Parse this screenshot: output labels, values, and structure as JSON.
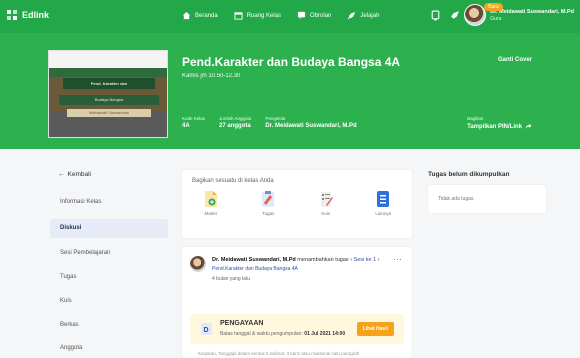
{
  "app": {
    "name": "Edlink"
  },
  "nav": {
    "home": "Beranda",
    "rooms": "Ruang Kelas",
    "discussion": "Obrolan",
    "schedule": "Jelajah"
  },
  "user": {
    "badge": "Baru",
    "name": "Dr. Meidawati Suswandari, M.Pd",
    "role": "Guru"
  },
  "class": {
    "title": "Pend.Karakter dan Budaya Bangsa 4A",
    "time": "Kamis jm 10.50-12.30",
    "edit_cover": "Ganti Cover",
    "cover_text": [
      "Pend. Karakter dan",
      "Budaya Bangsa",
      "Meidawati Suswandari"
    ],
    "meta": [
      {
        "label": "Kode Kelas",
        "value": "4A"
      },
      {
        "label": "Jumlah Anggota",
        "value": "27 anggota"
      },
      {
        "label": "Pengelola",
        "value": "Dr. Meidawati Suswandari, M.Pd"
      }
    ],
    "share": {
      "label": "Bagikan",
      "value": "Tampilkan PIN/Link"
    }
  },
  "sidebar": {
    "back": "Kembali",
    "items": [
      {
        "label": "Informasi Kelas",
        "active": false
      },
      {
        "label": "Diskusi",
        "active": true
      },
      {
        "label": "Sesi Pembelajaran",
        "active": false
      },
      {
        "label": "Tugas",
        "active": false
      },
      {
        "label": "Kuis",
        "active": false
      },
      {
        "label": "Berkas",
        "active": false
      },
      {
        "label": "Anggota",
        "active": false
      }
    ]
  },
  "share_box": {
    "title": "Bagikan sesuatu di kelas Anda",
    "tiles": [
      {
        "label": "Materi",
        "icon": "material-icon",
        "color": "#f3b33d"
      },
      {
        "label": "Tugas",
        "icon": "assignment-icon",
        "color": "#e85d4a"
      },
      {
        "label": "Kuis",
        "icon": "quiz-icon",
        "color": "#888888"
      },
      {
        "label": "Lainnya",
        "icon": "other-icon",
        "color": "#2f6fe0"
      }
    ]
  },
  "post": {
    "author": "Dr. Meidawati Suswandari, M.Pd",
    "action": "menambahkan tugas",
    "session": "Sesi ke 1",
    "class_name": "Pend.Karakter dan Budaya Bangsa 4A",
    "time": "4 bulan yang lalu",
    "assignment": {
      "title": "PENGAYAAN",
      "due_label": "Batas tanggal & waktu pengumpulan:",
      "due_value": "01 Jul 2021 14:00",
      "button": "Lihat Hasil"
    },
    "footer": "Kerjakan, Tanggapi dalam bentuk 5 kalimat. 3 baris atau maksimal satu paragraf!"
  },
  "pending": {
    "title": "Tugas belum dikumpulkan",
    "empty": "Tidak ada tugas."
  },
  "colors": {
    "primary_green": "#23a849",
    "banner_green": "#2db14f",
    "accent_orange": "#f7a21b",
    "active_bg": "#e7ebf7",
    "link_blue": "#2f4cb8"
  }
}
